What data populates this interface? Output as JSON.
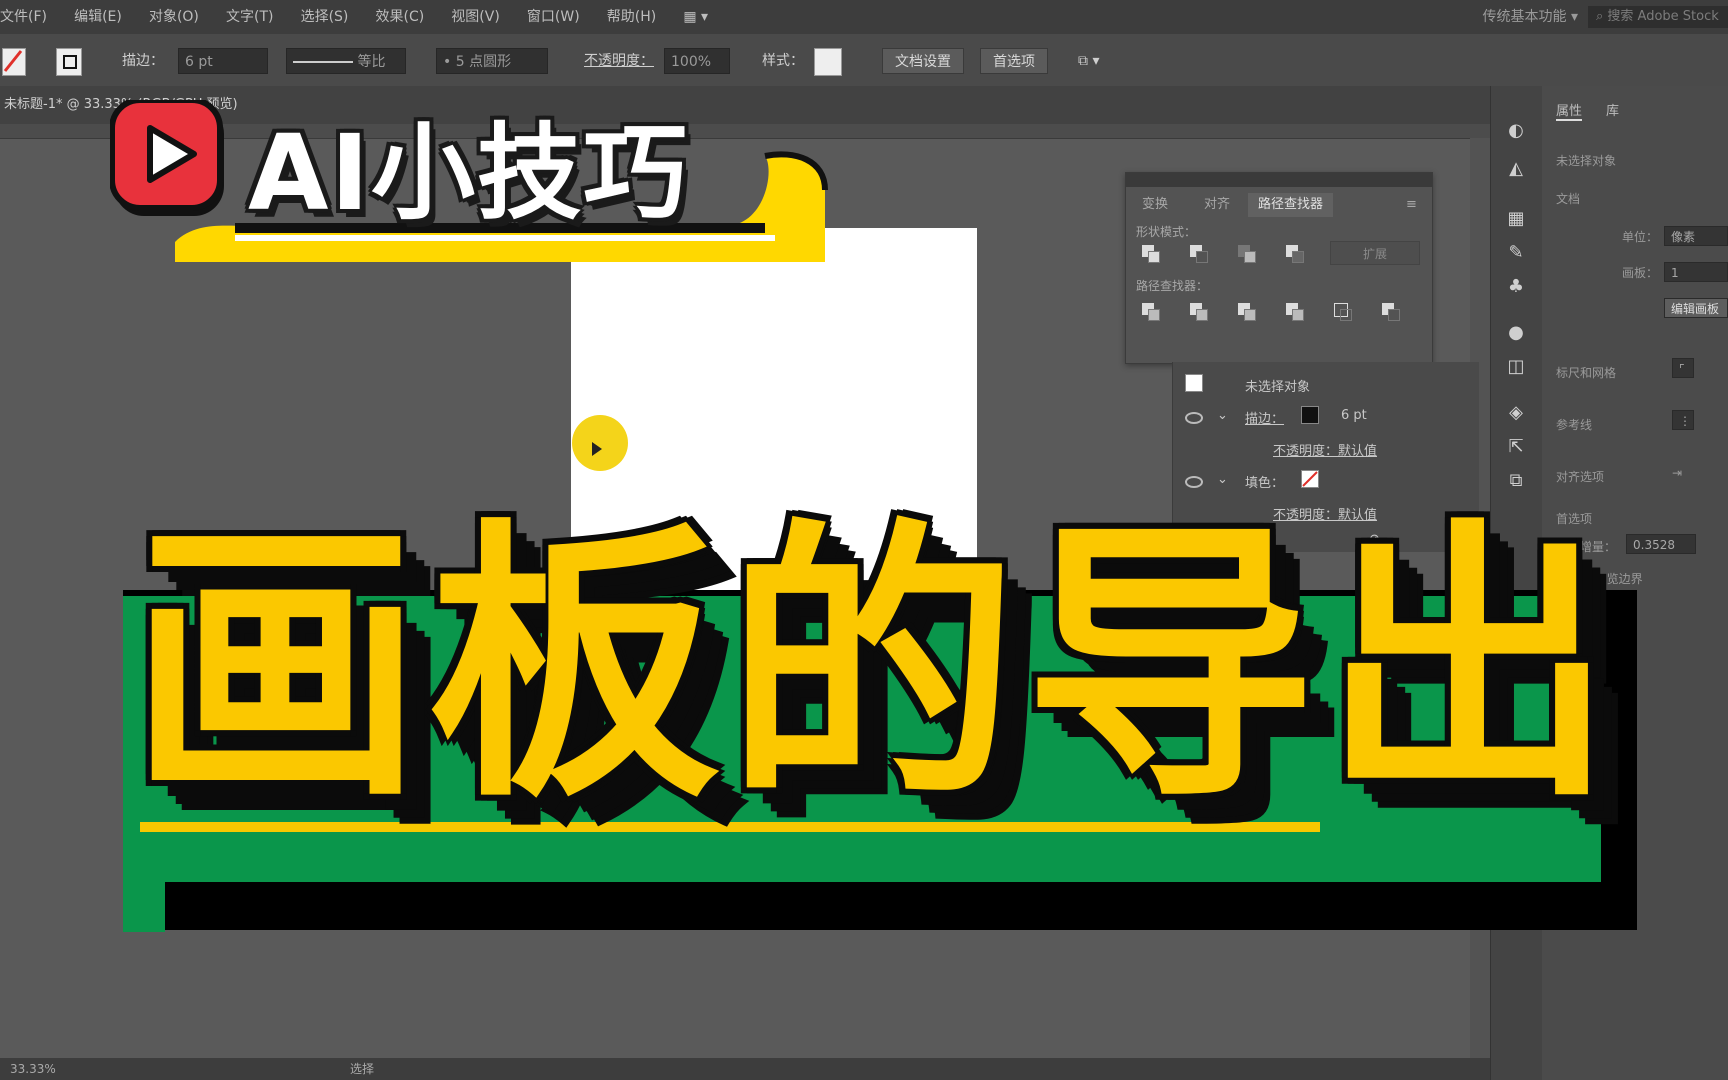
{
  "app": {
    "menus": [
      "文件(F)",
      "编辑(E)",
      "对象(O)",
      "文字(T)",
      "选择(S)",
      "效果(C)",
      "视图(V)",
      "窗口(W)",
      "帮助(H)"
    ],
    "workspace": "传统基本功能",
    "search_placeholder": "搜索 Adobe Stock"
  },
  "control_bar": {
    "stroke_label": "描边：",
    "stroke_value": "6 pt",
    "stroke_style": "等比",
    "brush": "5 点圆形",
    "opacity_label": "不透明度：",
    "opacity_value": "100%",
    "style_label": "样式：",
    "doc_setup_button": "文档设置",
    "preferences_button": "首选项"
  },
  "document": {
    "tab_label": "未标题-1* @ 33.33% (RGB/GPU 预览)",
    "zoom": "33.33%",
    "status": "选择"
  },
  "pathfinder_panel": {
    "tabs": [
      "变换",
      "对齐",
      "路径查找器"
    ],
    "active_tab": "路径查找器",
    "shape_modes_label": "形状模式：",
    "pathfinders_label": "路径查找器：",
    "expand_button": "扩展"
  },
  "appearance_panel": {
    "object_label": "未选择对象",
    "stroke_label": "描边：",
    "stroke_value": "6 pt",
    "opacity_label_1": "不透明度：默认值",
    "fill_label": "填色：",
    "opacity_label_2": "不透明度：默认值"
  },
  "properties_panel": {
    "tabs": [
      "属性",
      "库"
    ],
    "no_selection": "未选择对象",
    "doc_section": "文档",
    "unit_label": "单位：",
    "unit_value": "像素",
    "artboard_label": "画板：",
    "artboard_value": "1",
    "edit_artboard_button": "编辑画板",
    "ruler_grid": "标尺和网格",
    "guides": "参考线",
    "snap": "对齐选项",
    "preferences": "首选项",
    "keyboard_increment_label": "键盘增量：",
    "keyboard_increment_value": "0.3528",
    "preview_bounds": "使用预览边界"
  },
  "overlay": {
    "series_title": "AI小技巧",
    "main_title": "画板的导出",
    "colors": {
      "title_yellow": "#fbc800",
      "box_green": "#0a964b",
      "logo_red": "#e8323c",
      "badge_yellow": "#ffd800"
    }
  }
}
